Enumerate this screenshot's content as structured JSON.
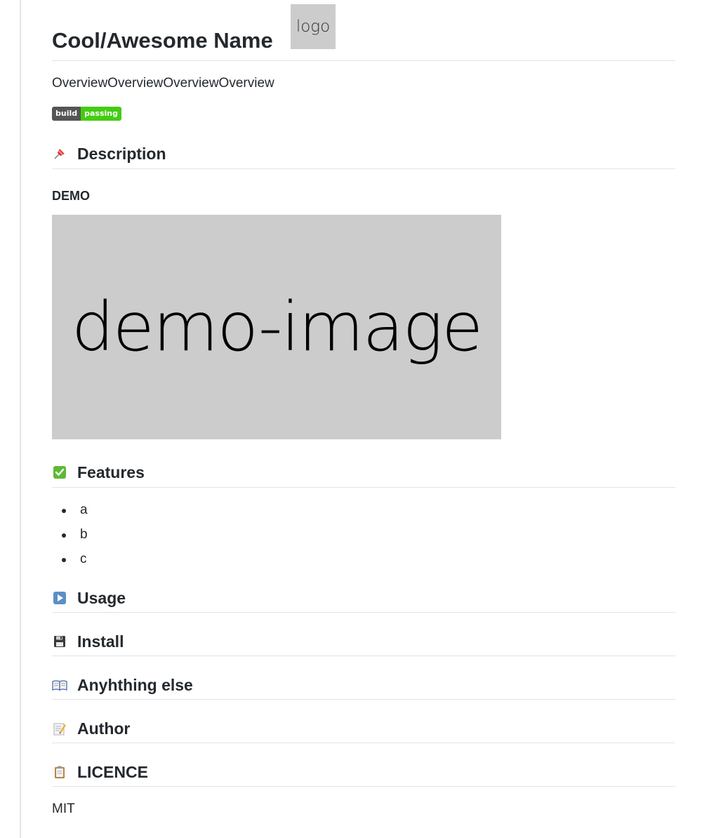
{
  "header": {
    "title": "Cool/Awesome Name",
    "logo_text": "logo"
  },
  "overview": "OverviewOverviewOverviewOverview",
  "badge": {
    "label": "build",
    "status": "passing",
    "status_color": "#4c1"
  },
  "sections": {
    "description": {
      "title": "Description",
      "icon": "pushpin-icon"
    },
    "demo_heading": "DEMO",
    "demo_image_text": "demo-image",
    "features": {
      "title": "Features",
      "icon": "check-mark-icon",
      "items": [
        "a",
        "b",
        "c"
      ]
    },
    "usage": {
      "title": "Usage",
      "icon": "play-button-icon"
    },
    "install": {
      "title": "Install",
      "icon": "floppy-disk-icon"
    },
    "anything_else": {
      "title": "Anyhthing else",
      "icon": "open-book-icon"
    },
    "author": {
      "title": "Author",
      "icon": "memo-icon"
    },
    "licence": {
      "title": "LICENCE",
      "icon": "clipboard-icon",
      "text": "MIT"
    }
  }
}
